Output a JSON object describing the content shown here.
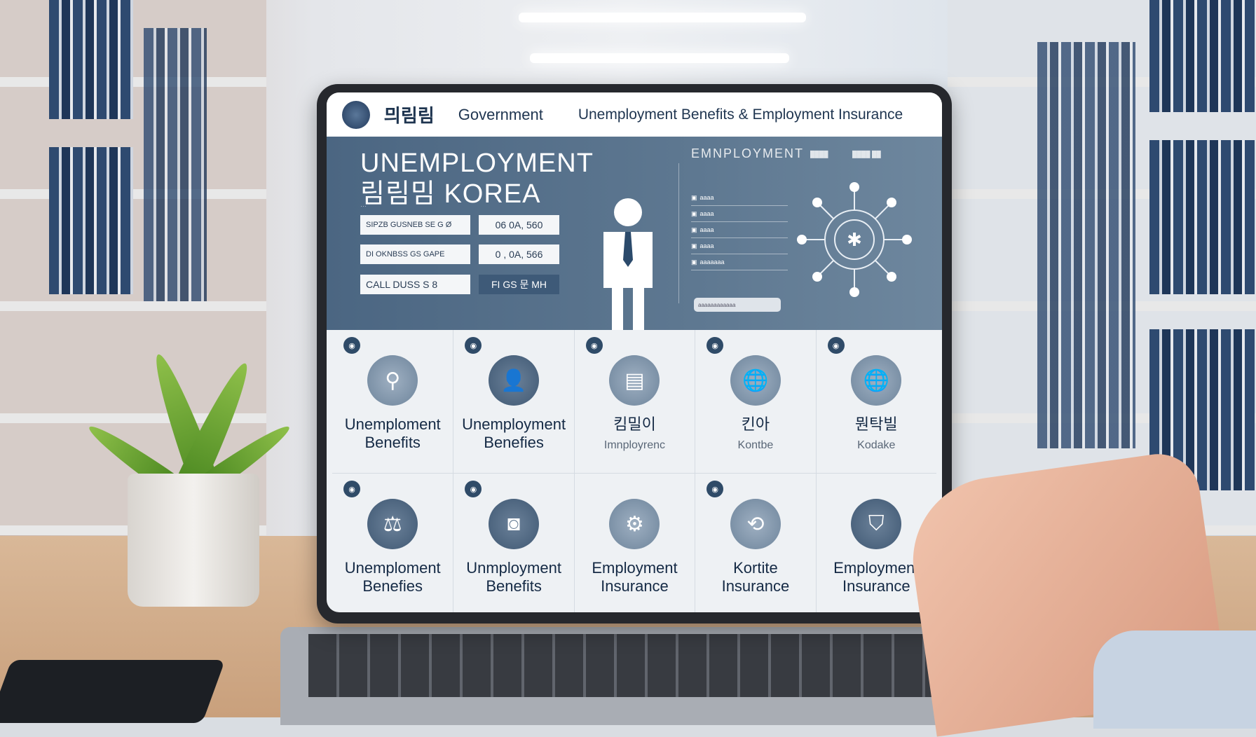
{
  "header": {
    "logo_text": "믜림림",
    "government": "Government",
    "title": "Unemployment Benefits & Employment Insurance"
  },
  "hero": {
    "title_line1": "UNEMPLOYMENT",
    "title_line2": "림림밈 KOREA",
    "subtitle": "…",
    "rows": [
      {
        "label": "SIPZB GUSNEB SE G Ø",
        "value": "06 0A, 560"
      },
      {
        "label": "DI OKNBSS GS GAPE",
        "value": "0 , 0A, 566"
      },
      {
        "label": "CALL DUSS S 8",
        "value": "FI GS 문 MH"
      }
    ],
    "panel": {
      "title": "EMNPLOYMENT",
      "tag1": "████",
      "tag2": "████ ██",
      "items": [
        "aaaa",
        "aaaa",
        "aaaa",
        "aaaa",
        "aaaaaaa"
      ],
      "button": "aaaaaaaaaaaa"
    }
  },
  "tiles": [
    {
      "icon": "network-person-icon",
      "line1": "Unemploment",
      "line2": "Benefits",
      "dark": false
    },
    {
      "icon": "person-icon",
      "line1": "Unemployment",
      "line2": "Benefies",
      "dark": true
    },
    {
      "icon": "document-icon",
      "line1": "킴밀이",
      "sub": "Imnployrenc",
      "dark": false
    },
    {
      "icon": "globe-icon",
      "line1": "킨아",
      "sub": "Kontbe",
      "dark": false
    },
    {
      "icon": "globe-icon",
      "line1": "뭔탁빌",
      "sub": "Kodake",
      "dark": false
    },
    {
      "icon": "handshake-icon",
      "line1": "Unemploment",
      "line2": "Benefies",
      "dark": true
    },
    {
      "icon": "camera-icon",
      "line1": "Unmployment",
      "line2": "Benefits",
      "dark": true
    },
    {
      "icon": "gear-cluster-icon",
      "line1": "Employment",
      "line2": "Insurance",
      "dark": false
    },
    {
      "icon": "arrows-icon",
      "line1": "Kortite",
      "line2": "Insurance",
      "dark": false
    },
    {
      "icon": "shield-icon",
      "line1": "Employment",
      "line2": "Insurance",
      "dark": true
    }
  ],
  "colors": {
    "hero": "#4b6682",
    "navy": "#1f3550",
    "tile_bg": "#eef1f4"
  }
}
